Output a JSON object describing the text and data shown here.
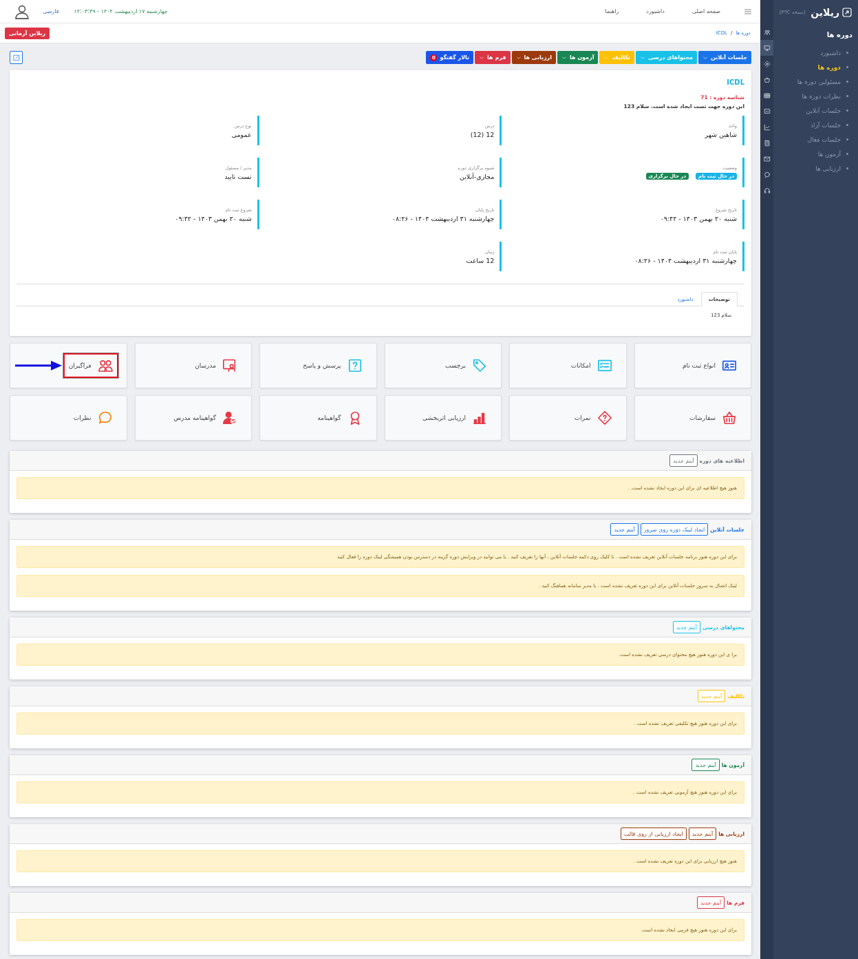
{
  "sidebar": {
    "logo": "ریلاین",
    "version": "[نسخه PTC]",
    "heading": "دوره ها",
    "items": [
      {
        "label": "داشبورد",
        "selected": false
      },
      {
        "label": "دوره ها",
        "selected": true
      },
      {
        "label": "مسئولین دوره ها",
        "selected": false
      },
      {
        "label": "نظرات دوره ها",
        "selected": false
      },
      {
        "label": "جلسات آنلاین",
        "selected": false
      },
      {
        "label": "جلسات آزاد",
        "selected": false
      },
      {
        "label": "جلسات فعال",
        "selected": false
      },
      {
        "label": "آزمون ها",
        "selected": false
      },
      {
        "label": "ارزیابی ها",
        "selected": false
      }
    ],
    "rail": [
      {
        "selected": false
      },
      {
        "selected": true
      },
      {
        "selected": false
      },
      {
        "selected": false
      },
      {
        "selected": false
      },
      {
        "selected": false
      },
      {
        "selected": false
      },
      {
        "selected": false
      },
      {
        "selected": false
      },
      {
        "selected": false
      },
      {
        "selected": false
      }
    ]
  },
  "header": {
    "links": [
      "صفحه اصلی",
      "داشبورد",
      "راهنما"
    ],
    "datetime": "چهارشنبه ۱۷ اردیبهشت ۱۴۰۴ - ۱۴:۰۳:۳۹",
    "language": "فارسی"
  },
  "breadcrumb": {
    "items": [
      "دوره ها",
      "ICDL"
    ],
    "separator": "/"
  },
  "user_button": "ریلاین آرمانی",
  "toolbar": [
    {
      "label": "جلسات آنلاین",
      "color": "#1a73e8",
      "dropdown": true
    },
    {
      "label": "محتواهای درسی",
      "color": "#17c1e8",
      "dropdown": true
    },
    {
      "label": "تکالیف",
      "color": "#ffc107",
      "dropdown": true
    },
    {
      "label": "آزمون ها",
      "color": "#198754",
      "dropdown": true
    },
    {
      "label": "ارزیابی ها",
      "color": "#9c3a0c",
      "dropdown": true
    },
    {
      "label": "فرم ها",
      "color": "#dc3545",
      "dropdown": true
    },
    {
      "label": "تالار گفتگو",
      "color": "#1a56e8",
      "dropdown": false,
      "badge": "0"
    }
  ],
  "course": {
    "title": "ICDL",
    "id_line": "شناسه دوره : 71",
    "description": "این دوره جهت تست ایجاد شده است. سلام 123",
    "fields": [
      {
        "kind": "text",
        "label": "واحد",
        "value": "شاهین شهر"
      },
      {
        "kind": "text",
        "label": "درس",
        "value": "12 (12)"
      },
      {
        "kind": "text",
        "label": "نوع درس",
        "value": "عمومی"
      },
      {
        "kind": "badges",
        "label": "وضعیت",
        "badges": [
          {
            "text": "در حال ثبت نام",
            "color": "#17b3e8"
          },
          {
            "text": "در حال برگزاری",
            "color": "#198754"
          }
        ]
      },
      {
        "kind": "text",
        "label": "شیوه برگزاری دوره",
        "value": "مجازی-آنلاین"
      },
      {
        "kind": "text",
        "label": "مدیر / مسئول",
        "value": "تست تایید"
      },
      {
        "kind": "text",
        "label": "تاریخ شروع",
        "value": "شنبه ۲۰ بهمن ۱۴۰۳ - ۰۹:۴۲"
      },
      {
        "kind": "text",
        "label": "تاریخ پایان",
        "value": "چهارشنبه ۳۱ اردیبهشت ۱۴۰۴ - ۰۸:۲۶"
      },
      {
        "kind": "text",
        "label": "شروع ثبت نام",
        "value": "شنبه ۲۰ بهمن ۱۴۰۳ - ۰۹:۴۲"
      },
      {
        "kind": "text",
        "label": "پایان ثبت نام",
        "value": "چهارشنبه ۳۱ اردیبهشت ۱۴۰۴ - ۰۸:۲۶"
      },
      {
        "kind": "text",
        "label": "زمان",
        "value": "12 ساعت"
      }
    ],
    "tabs": [
      {
        "label": "توضیحات",
        "selected": true
      },
      {
        "label": "داشبورد",
        "selected": false
      }
    ],
    "tab_content": "سلام 123"
  },
  "tiles": [
    {
      "label": "انواع ثبت نام",
      "color": "#1a56e8",
      "highlighted": false
    },
    {
      "label": "امکانات",
      "color": "#17c1e8",
      "highlighted": false
    },
    {
      "label": "برچسب",
      "color": "#17c1e8",
      "highlighted": false
    },
    {
      "label": "پرسش و پاسخ",
      "color": "#17c1e8",
      "highlighted": false
    },
    {
      "label": "مدرسان",
      "color": "#e63946",
      "highlighted": false
    },
    {
      "label": "فراگیران",
      "color": "#e63946",
      "highlighted": true
    },
    {
      "label": "سفارشات",
      "color": "#e63946",
      "highlighted": false
    },
    {
      "label": "نمرات",
      "color": "#e63946",
      "highlighted": false
    },
    {
      "label": "ارزیابی اثربخشی",
      "color": "#e63946",
      "highlighted": false
    },
    {
      "label": "گواهینامه",
      "color": "#e63946",
      "highlighted": false
    },
    {
      "label": "گواهینامه مدرس",
      "color": "#e63946",
      "highlighted": false
    },
    {
      "label": "نظرات",
      "color": "#f57c00",
      "highlighted": false
    }
  ],
  "sections": [
    {
      "title": "اطلاعیه های دوره",
      "color": "#6c757d",
      "buttons": [
        "آیتم جدید"
      ],
      "alerts": [
        "هنوز هیچ اطلاعیه ای برای این دوره ایجاد نشده است. ."
      ]
    },
    {
      "title": "جلسات آنلاین",
      "color": "#1a73e8",
      "buttons": [
        "ایجاد لینک دوره روی سرور",
        "آیتم جدید"
      ],
      "alerts": [
        "برای این دوره هنوز برنامه جلسات آنلاین تعریف نشده است . با کلیک روی دکمه جلسات آنلاین ، آنها را تعریف کنید . یا می توانید در ویرایش دوره گزینه در دسترس بودن همیشگی لینک دوره را فعال کنید",
        "لینک اتصال به سرور جلسات آنلاین برای این دوره تعریف نشده است . با مدیر سامانه هماهنگ کنید ."
      ]
    },
    {
      "title": "محتواهای درسی",
      "color": "#17c1e8",
      "buttons": [
        "آیتم جدید"
      ],
      "alerts": [
        "برا ی این دوره هنوز هیچ محتوای درسی تعریف نشده است."
      ]
    },
    {
      "title": "تکالیف",
      "color": "#ffc107",
      "buttons": [
        "آیتم جدید"
      ],
      "alerts": [
        "برای این دوره هنوز هیچ تکلیفی تعریف نشده است ."
      ]
    },
    {
      "title": "آزمون ها",
      "color": "#198754",
      "buttons": [
        "آیتم جدید"
      ],
      "alerts": [
        "برای این دوره هنوز هیچ آزمونی تعریف نشده است ."
      ]
    },
    {
      "title": "ارزیابی ها",
      "color": "#9c3a0c",
      "buttons": [
        "آیتم جدید",
        "ایجاد ارزیابی از روی قالب"
      ],
      "alerts": [
        "هنوز هیچ ارزیابی برای این دوره تعریف نشده است ."
      ]
    },
    {
      "title": "فرم ها",
      "color": "#dc3545",
      "buttons": [
        "آیتم جدید"
      ],
      "alerts": [
        "برای این دوره هنوز هیچ فرمی ایجاد نشده است."
      ]
    }
  ]
}
